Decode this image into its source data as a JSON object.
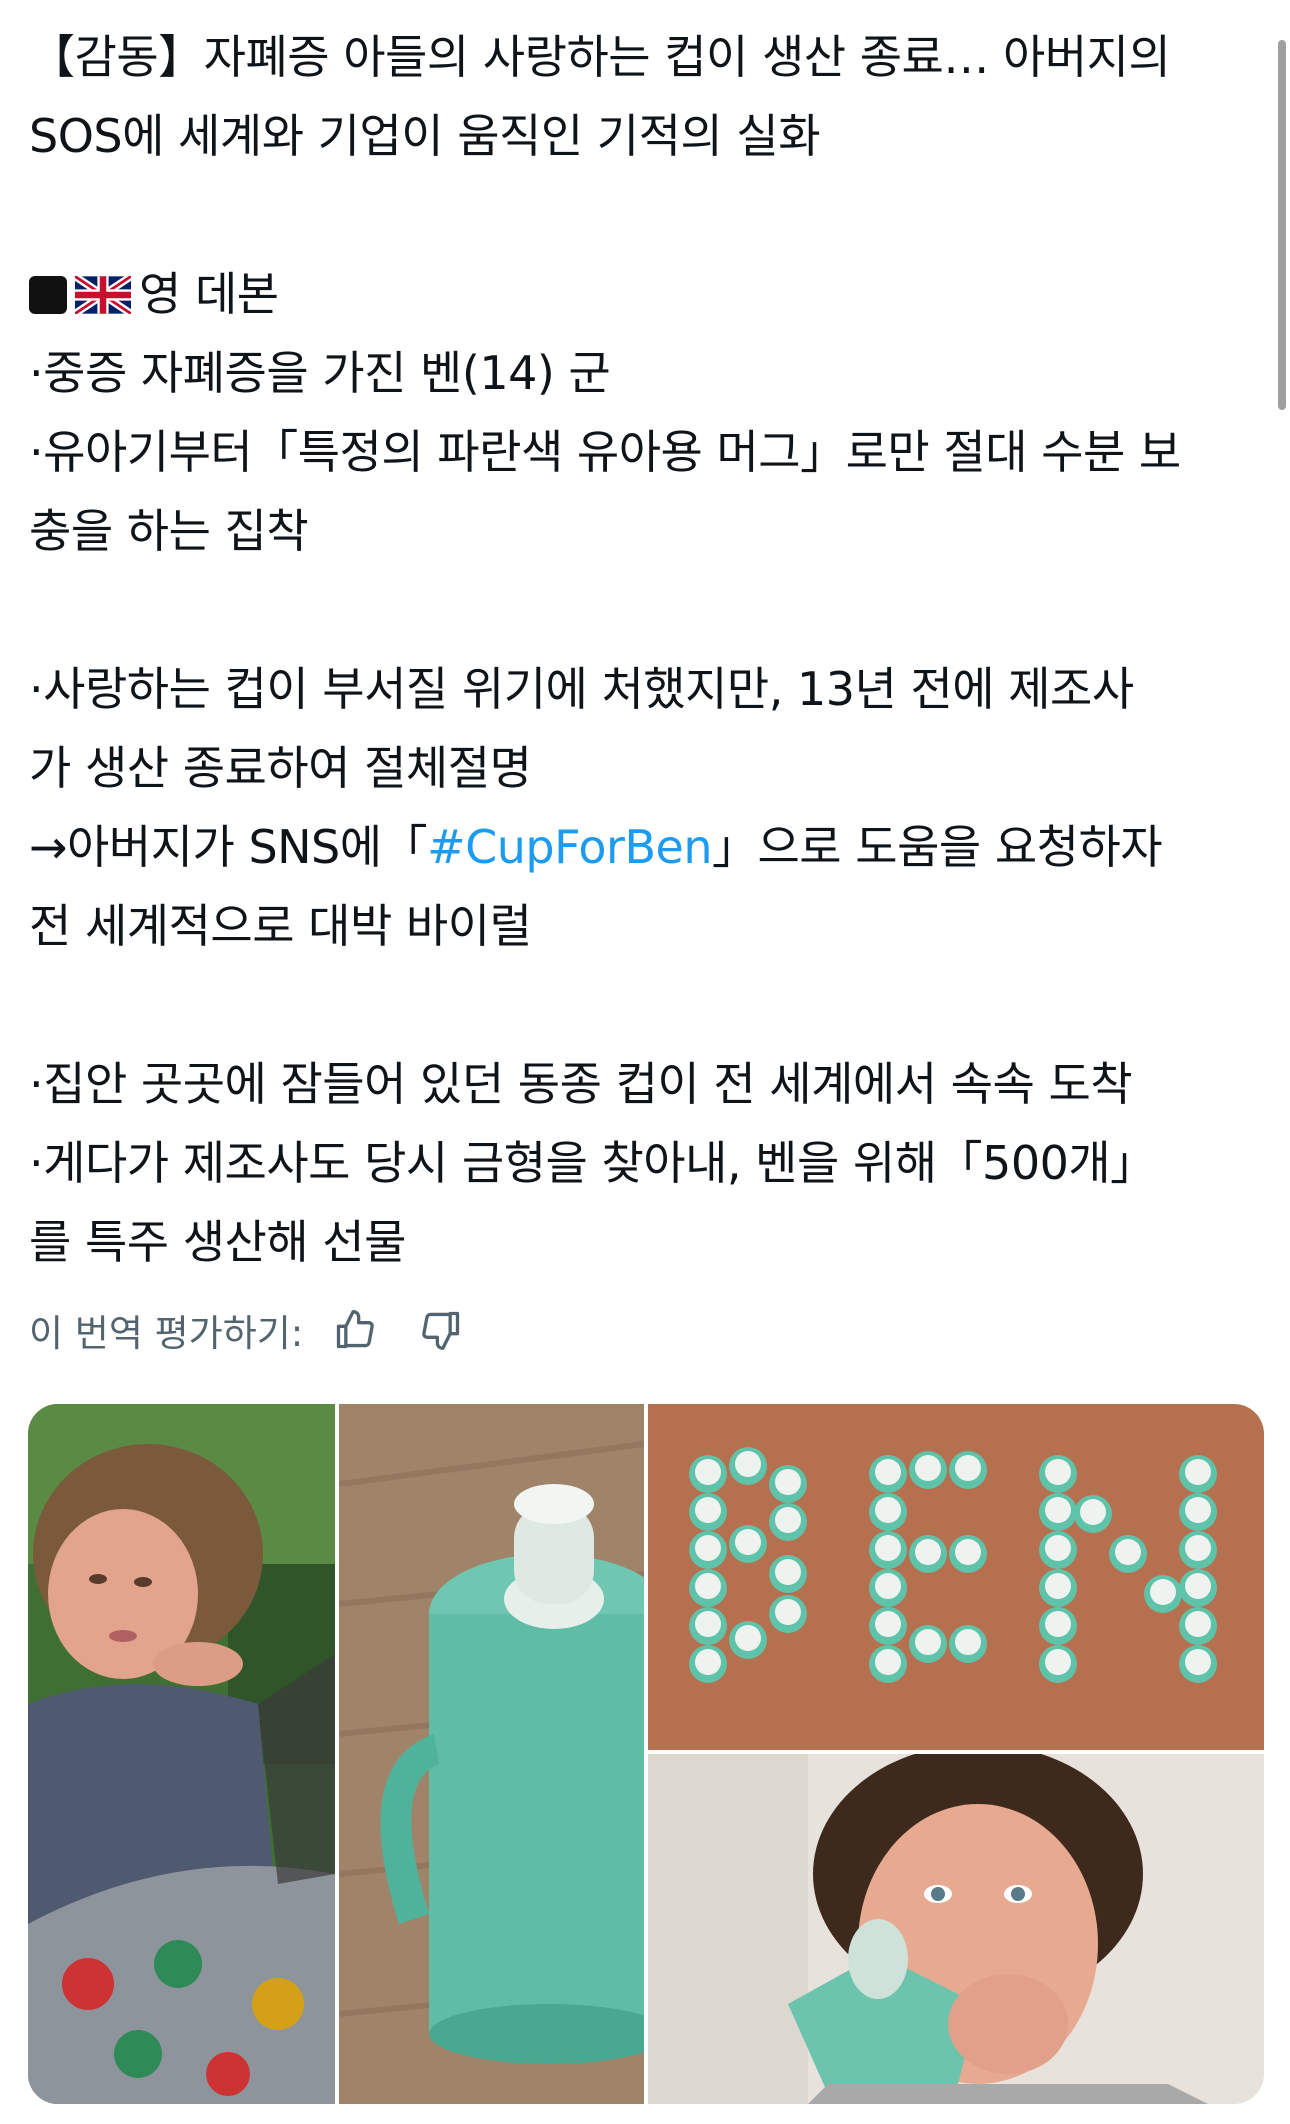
{
  "tweet": {
    "line1": "【감동】자폐증 아들의 사랑하는 컵이 생산 종료… 아버지의",
    "line2": "SOS에 세계와 기업이 움직인 기적의 실화",
    "line3_text": "영 데본",
    "line4": "·중증 자폐증을 가진 벤(14) 군",
    "line5": "·유아기부터「특정의 파란색 유아용 머그」로만 절대 수분 보",
    "line6": "충을 하는 집착",
    "line7": "·사랑하는 컵이 부서질 위기에 처했지만, 13년 전에 제조사",
    "line8": "가 생산 종료하여 절체절명",
    "line9_before": "→아버지가 SNS에「",
    "line9_hashtag": "#CupForBen",
    "line9_after": "」으로 도움을 요청하자",
    "line10": "전 세계적으로 대박 바이럴",
    "line11": "·집안 곳곳에 잠들어 있던 동종 컵이 전 세계에서 속속 도착",
    "line12": "·게다가 제조사도 당시 금형을 찾아내, 벤을 위해「500개」",
    "line13": "를 특주 생산해 선물",
    "square_icon": "black-square",
    "flag_icon": "uk-flag"
  },
  "translation_rating": {
    "label": "이 번역 평가하기:",
    "thumbs_up_icon": "thumbs-up-icon",
    "thumbs_down_icon": "thumbs-down-icon"
  },
  "media": {
    "images": [
      "boy-outdoors-photo",
      "teal-sippy-cup-photo",
      "cups-spelling-ben-photo",
      "boy-drinking-from-cup-photo"
    ],
    "cups_spelled_word": "BEN"
  },
  "colors": {
    "text": "#0f1419",
    "secondary_text": "#536471",
    "hashtag": "#1d9bf0",
    "cup_teal": "#5fc3aa"
  }
}
